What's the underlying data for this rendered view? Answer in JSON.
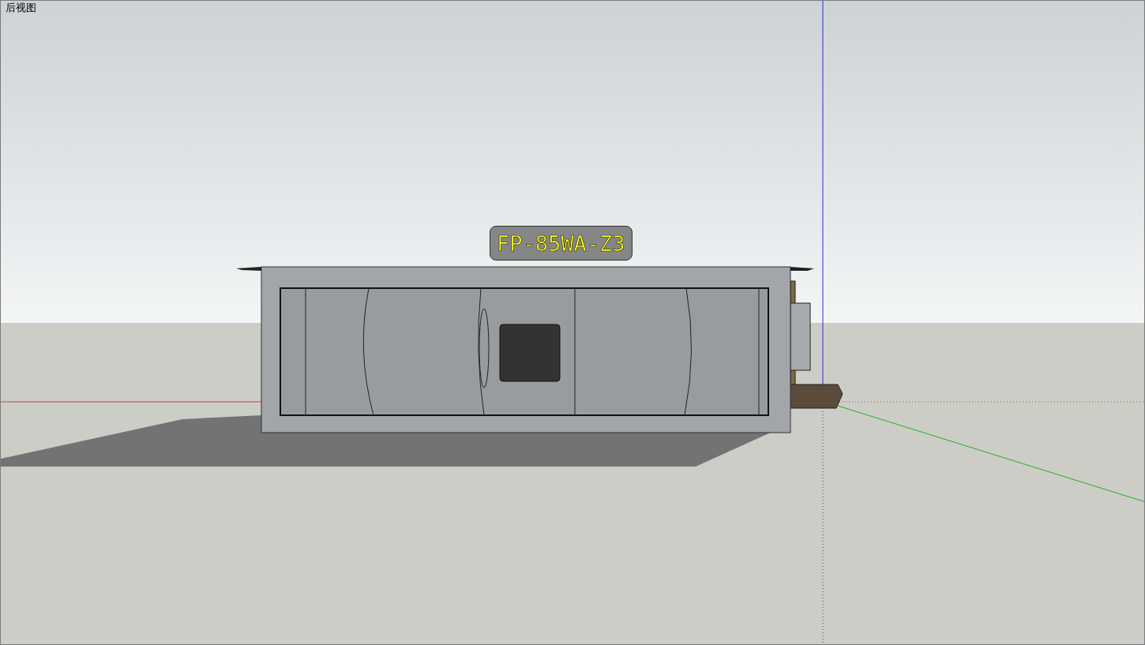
{
  "view_name": "后视图",
  "model_label": "FP-85WA-Z3"
}
